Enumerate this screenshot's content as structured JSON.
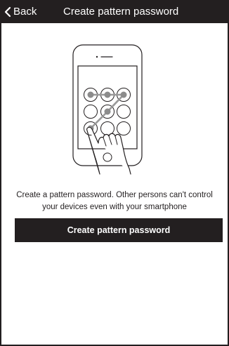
{
  "header": {
    "back_label": "Back",
    "title": "Create pattern password",
    "back_icon": "chevron-left-icon"
  },
  "main": {
    "illustration_icon": "phone-pattern-lock-illustration",
    "description": "Create a pattern password. Other persons can't control your devices even with your smartphone",
    "cta_label": "Create pattern password"
  },
  "colors": {
    "header_bg": "#231f20",
    "button_bg": "#231f20",
    "text": "#231f20",
    "background": "#ffffff"
  }
}
